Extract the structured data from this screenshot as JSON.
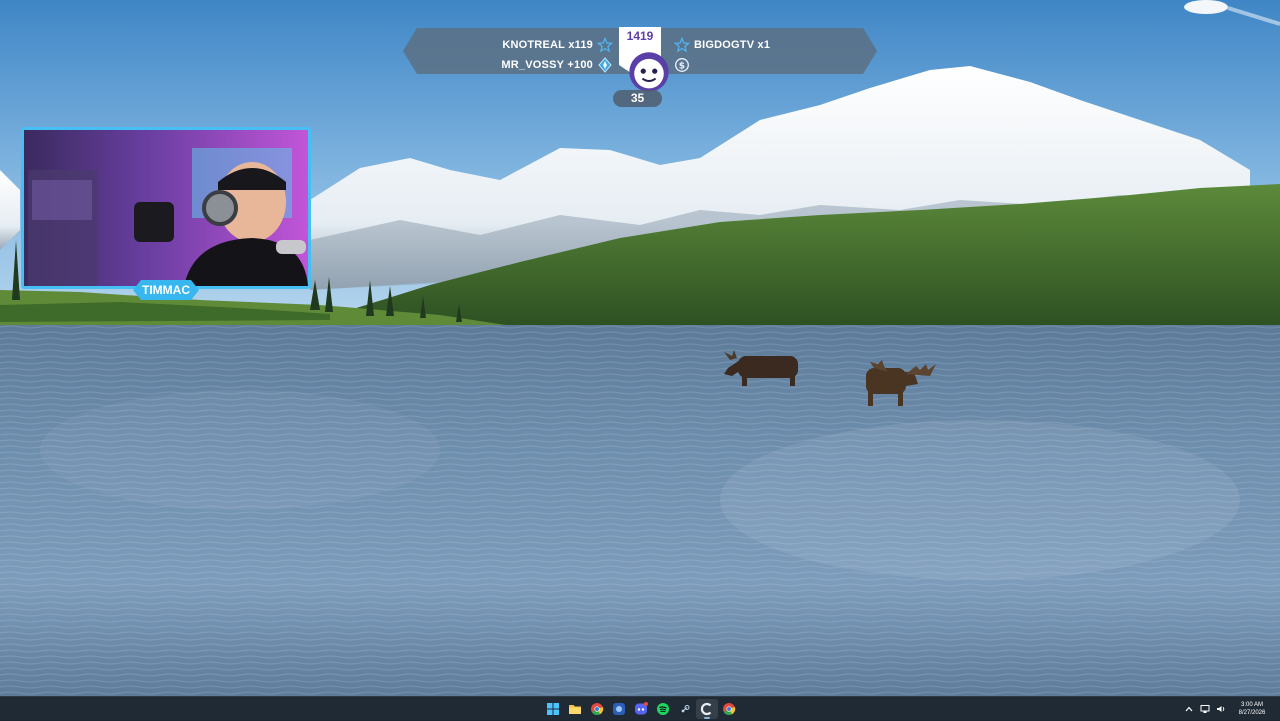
{
  "stream_alert": {
    "left": [
      {
        "name": "KNOTREAL",
        "amount": "x119",
        "icon": "star-outline-icon"
      },
      {
        "name": "MR_VOSSY",
        "amount": "+100",
        "icon": "diamond-icon"
      }
    ],
    "right": [
      {
        "name": "BIGDOGTV",
        "amount": "x1",
        "icon": "star-outline-icon"
      },
      {
        "name": "",
        "amount": "",
        "icon": "dollar-icon"
      }
    ],
    "center_count": "1419",
    "sub_count": "35"
  },
  "webcam": {
    "streamer_name": "TIMMAC"
  },
  "taskbar": {
    "apps": [
      {
        "name": "windows-start",
        "icon": "windows-logo-icon"
      },
      {
        "name": "file-explorer",
        "icon": "folder-icon"
      },
      {
        "name": "chrome",
        "icon": "chrome-icon"
      },
      {
        "name": "app-blue",
        "icon": "app-icon"
      },
      {
        "name": "discord",
        "icon": "discord-icon"
      },
      {
        "name": "spotify",
        "icon": "spotify-icon"
      },
      {
        "name": "steam",
        "icon": "steam-icon"
      },
      {
        "name": "app-c",
        "icon": "c-app-icon"
      },
      {
        "name": "chrome-2",
        "icon": "chrome-icon"
      }
    ],
    "tray": {
      "time": "3:00 AM",
      "date": "8/27/2026"
    }
  },
  "colors": {
    "accent_blue": "#46c0f4",
    "alert_bar": "#5c6e80",
    "shield_purple": "#5a3fa8",
    "taskbar": "#1f2a35"
  }
}
